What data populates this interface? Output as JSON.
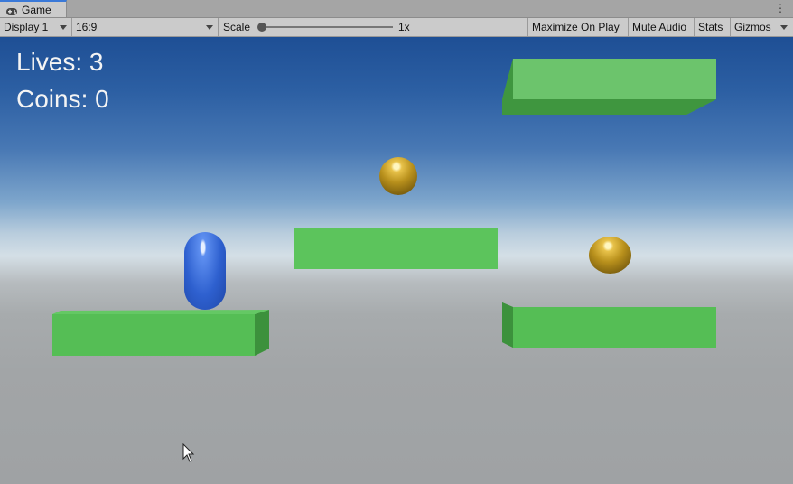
{
  "window": {
    "tab_label": "Game",
    "tab_icon": "gamepad-icon"
  },
  "toolbar": {
    "display": "Display 1",
    "aspect": "16:9",
    "scale_label": "Scale",
    "scale_value": "1x",
    "maximize_on_play": "Maximize On Play",
    "mute_audio": "Mute Audio",
    "stats": "Stats",
    "gizmos": "Gizmos"
  },
  "hud": {
    "lives": "Lives: 3",
    "coins": "Coins: 0"
  },
  "colors": {
    "platform_green": "#5cc95c",
    "player_blue": "#2e60cf",
    "coin_gold": "#b8901c"
  }
}
